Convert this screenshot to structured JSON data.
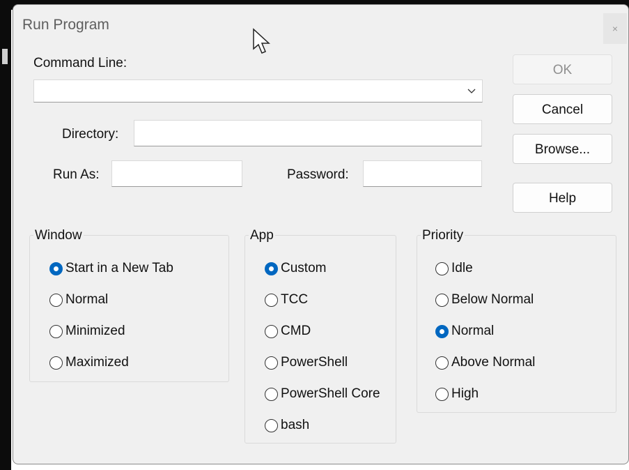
{
  "dialog": {
    "title": "Run Program",
    "close_label": "×"
  },
  "command_line": {
    "label": "Command Line:",
    "value": ""
  },
  "directory": {
    "label": "Directory:",
    "value": ""
  },
  "run_as": {
    "label": "Run As:",
    "value": ""
  },
  "password": {
    "label": "Password:",
    "value": ""
  },
  "buttons": {
    "ok": "OK",
    "cancel": "Cancel",
    "browse": "Browse...",
    "help": "Help"
  },
  "window_group": {
    "title": "Window",
    "options": [
      "Start in a New Tab",
      "Normal",
      "Minimized",
      "Maximized"
    ],
    "selected": "Start in a New Tab"
  },
  "app_group": {
    "title": "App",
    "options": [
      "Custom",
      "TCC",
      "CMD",
      "PowerShell",
      "PowerShell Core",
      "bash"
    ],
    "selected": "Custom"
  },
  "priority_group": {
    "title": "Priority",
    "options": [
      "Idle",
      "Below Normal",
      "Normal",
      "Above Normal",
      "High"
    ],
    "selected": "Normal"
  },
  "colors": {
    "accent": "#0067c0",
    "dialog_bg": "#f0f0f0",
    "terminal_bg": "#0c0c0c"
  }
}
